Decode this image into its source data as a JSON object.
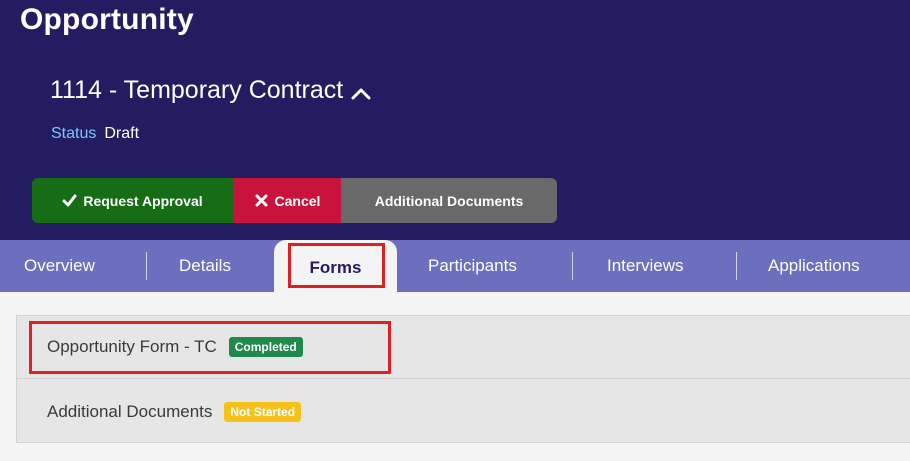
{
  "header": {
    "title": "Opportunity",
    "record_title": "1114 - Temporary Contract",
    "status_label": "Status",
    "status_value": "Draft",
    "background_color": "#241c60"
  },
  "actions": {
    "request_approval": "Request Approval",
    "cancel": "Cancel",
    "additional_documents": "Additional Documents",
    "colors": {
      "approve": "#166d16",
      "cancel": "#c8143c",
      "docs": "#696969"
    }
  },
  "tabs": {
    "items": [
      "Overview",
      "Details",
      "Forms",
      "Participants",
      "Interviews",
      "Applications"
    ],
    "active": "Forms"
  },
  "forms": [
    {
      "name": "Opportunity Form - TC",
      "status": "Completed",
      "status_color": "#1f8a4a"
    },
    {
      "name": "Additional Documents",
      "status": "Not Started",
      "status_color": "#f6c21a"
    }
  ],
  "icons": {
    "record_toggle": "chevron-up-icon",
    "approve": "checkmark-icon",
    "cancel": "x-icon"
  },
  "highlight_color": "#e02020"
}
